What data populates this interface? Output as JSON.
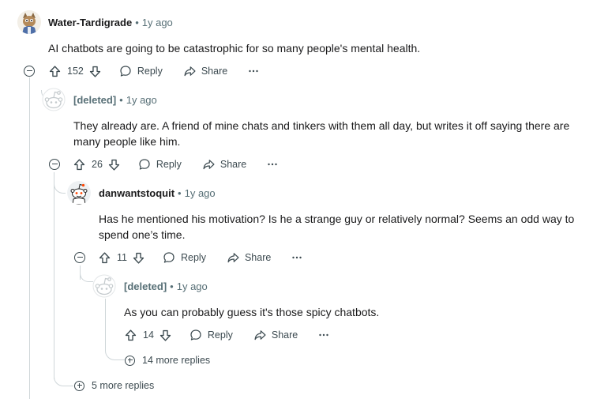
{
  "comments": [
    {
      "user": "Water-Tardigrade",
      "separator": "•",
      "time": "1y ago",
      "text": "AI chatbots are going to be catastrophic for so many people's mental health.",
      "score": "152",
      "reply_label": "Reply",
      "share_label": "Share",
      "avatar": "tardigrade-cartoon-avatar"
    },
    {
      "user": "[deleted]",
      "separator": "•",
      "time": "1y ago",
      "text_line1": "They already are. A friend of mine chats and tinkers with them all day, but writes it off saying there are",
      "text_line2": "many people like him.",
      "score": "26",
      "reply_label": "Reply",
      "share_label": "Share",
      "avatar": "default-snoo-avatar"
    },
    {
      "user": "danwantstoquit",
      "separator": "•",
      "time": "1y ago",
      "text_line1": "Has he mentioned his motivation? Is he a strange guy or relatively normal? Seems an odd way to",
      "text_line2": "spend one’s time.",
      "score": "11",
      "reply_label": "Reply",
      "share_label": "Share",
      "avatar": "snoo-avatar"
    },
    {
      "user": "[deleted]",
      "separator": "•",
      "time": "1y ago",
      "text": "As you can probably guess it's those spicy chatbots.",
      "score": "14",
      "reply_label": "Reply",
      "share_label": "Share",
      "avatar": "default-snoo-avatar"
    }
  ],
  "more_replies": [
    {
      "label": "14 more replies"
    },
    {
      "label": "5 more replies"
    }
  ],
  "icons": {
    "upvote": "upvote-arrow-icon",
    "downvote": "downvote-arrow-icon",
    "reply": "speech-bubble-icon",
    "share": "share-arrow-icon",
    "overflow": "ellipsis-icon",
    "collapse": "minus-circle-icon",
    "expand": "plus-circle-icon"
  },
  "colors": {
    "text": "#1a1a1b",
    "meta": "#576f76",
    "action": "#3c4a50",
    "thread_line": "#cfd6d9"
  }
}
